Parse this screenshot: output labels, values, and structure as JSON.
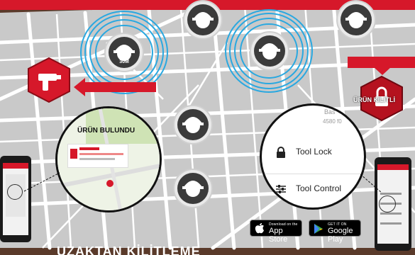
{
  "distance_label": "30M",
  "lock_badge_label": "ÜRÜN KİLİTLİ",
  "found_panel": {
    "title": "ÜRÜN BULUNDU"
  },
  "tool_menu": {
    "partial_text_top": "Bas",
    "partial_text_2": "4580 f0",
    "items": [
      {
        "label": "Tool Lock",
        "icon": "lock-icon"
      },
      {
        "label": "Tool Control",
        "icon": "sliders-icon"
      }
    ]
  },
  "app_store": {
    "small": "Download on the",
    "big": "App Store",
    "icon": "apple-icon"
  },
  "google_play": {
    "small": "GET IT ON",
    "big": "Google Play",
    "icon": "play-icon"
  },
  "bottom_headline": "UZAKTAN KİLİTLEME",
  "colors": {
    "brand_red": "#d6182a",
    "map_bg": "#c9c9c9",
    "road": "#ffffff",
    "pulse": "#2aa8e0"
  }
}
